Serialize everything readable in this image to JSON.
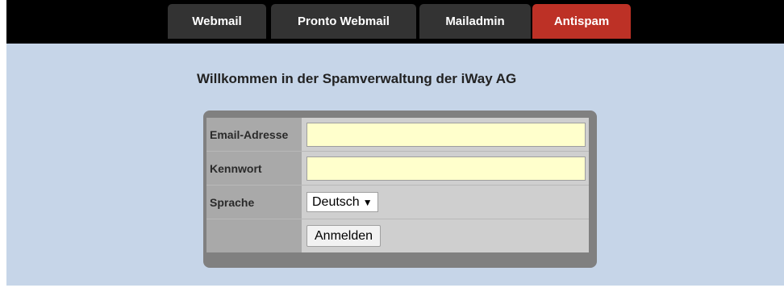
{
  "nav": {
    "tabs": [
      {
        "label": "Webmail",
        "active": false
      },
      {
        "label": "Pronto Webmail",
        "active": false
      },
      {
        "label": "Mailadmin",
        "active": false
      },
      {
        "label": "Antispam",
        "active": true
      }
    ]
  },
  "main": {
    "welcome": "Willkommen in der Spamverwaltung der iWay AG"
  },
  "login": {
    "email_label": "Email-Adresse",
    "email_value": "",
    "password_label": "Kennwort",
    "password_value": "",
    "language_label": "Sprache",
    "language_selected": "Deutsch",
    "language_caret": "▼",
    "submit_label": "Anmelden"
  },
  "colors": {
    "background": "#c6d5e8",
    "topbar": "#000000",
    "tab": "#333333",
    "tab_active": "#bd3126",
    "input_fill": "#ffffcc",
    "panel": "#808080"
  }
}
